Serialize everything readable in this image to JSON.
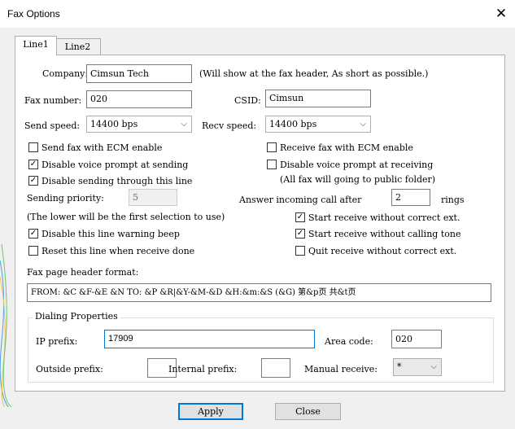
{
  "window": {
    "title": "Fax Options",
    "close_glyph": "✕"
  },
  "tabs": [
    "Line1",
    "Line2"
  ],
  "fields": {
    "company_label": "Company:",
    "company_value": "Cimsun Tech",
    "company_note": "(Will show at the fax header, As short as possible.)",
    "fax_number_label": "Fax number:",
    "fax_number_value": "020",
    "csid_label": "CSID:",
    "csid_value": "Cimsun",
    "send_speed_label": "Send speed:",
    "send_speed_value": "14400 bps",
    "recv_speed_label": "Recv speed:",
    "recv_speed_value": "14400 bps"
  },
  "checkboxes": {
    "send_ecm": {
      "label": "Send fax with ECM enable",
      "checked": false
    },
    "receive_ecm": {
      "label": "Receive fax with ECM enable",
      "checked": false
    },
    "disable_voice_sending": {
      "label": "Disable voice prompt at sending",
      "checked": true
    },
    "disable_voice_receiving": {
      "label": "Disable voice prompt at receiving",
      "checked": false
    },
    "disable_sending_line": {
      "label": "Disable sending through this line",
      "checked": true
    },
    "start_receive_correct_ext": {
      "label": "Start receive without correct ext.",
      "checked": true
    },
    "disable_warning_beep": {
      "label": "Disable this line warning beep",
      "checked": true
    },
    "start_receive_calling_tone": {
      "label": "Start receive without calling tone",
      "checked": true
    },
    "reset_line": {
      "label": "Reset this line when receive done",
      "checked": false
    },
    "quit_receive": {
      "label": "Quit receive without correct ext.",
      "checked": false
    }
  },
  "public_folder_note": "(All fax will going to public folder)",
  "priority": {
    "label": "Sending priority:",
    "value": "5",
    "note": "(The lower will be the first selection to use)"
  },
  "answer": {
    "label": "Answer incoming call after",
    "value": "2",
    "suffix": "rings"
  },
  "header_format": {
    "label": "Fax page header format:",
    "value": "FROM: &C &F-&E &N    TO: &P &R|&Y-&M-&D &H:&m:&S (&G) 第&p页 共&t页"
  },
  "dialing": {
    "title": "Dialing Properties",
    "ip_prefix_label": "IP prefix:",
    "ip_prefix_value": "17909",
    "area_code_label": "Area code:",
    "area_code_value": "020",
    "outside_prefix_label": "Outside prefix:",
    "outside_prefix_value": "",
    "internal_prefix_label": "Internal prefix:",
    "internal_prefix_value": "",
    "manual_receive_label": "Manual receive:",
    "manual_receive_value": "*"
  },
  "buttons": {
    "apply": "Apply",
    "close": "Close"
  },
  "icons": {
    "dropdown": "chevron-down-icon",
    "check": "checkmark-icon"
  },
  "colors": {
    "focus": "#0078d7",
    "panel": "#ffffff",
    "dialog": "#f0f0f0"
  }
}
